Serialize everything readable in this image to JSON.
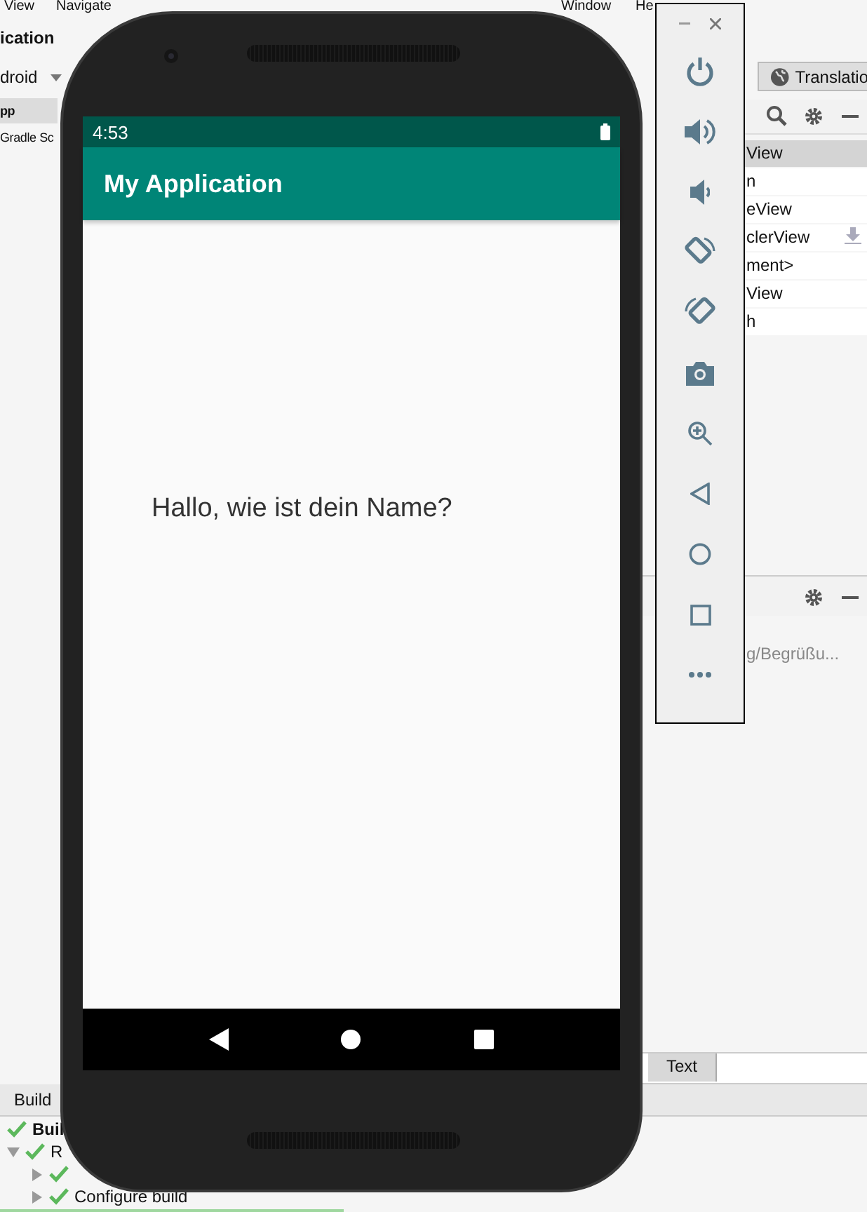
{
  "ide": {
    "menu": [
      "View",
      "Navigate",
      "Window",
      "He"
    ],
    "project_title": "ication",
    "project_view": "droid",
    "project_tree": [
      {
        "label": "pp",
        "selected": true
      },
      {
        "label": "Gradle Sc",
        "selected": false
      }
    ],
    "translations_tab": "Translatio",
    "component_tree": [
      {
        "label": "View",
        "selected": true
      },
      {
        "label": "n",
        "selected": false
      },
      {
        "label": "eView",
        "selected": false
      },
      {
        "label": "clerView",
        "selected": false
      },
      {
        "label": "ment>",
        "selected": false
      },
      {
        "label": "View",
        "selected": false
      },
      {
        "label": "h",
        "selected": false
      }
    ],
    "attribute_value": "g/Begrüßu...",
    "editor_tab": "Text",
    "build_tab": "Build",
    "build_tree": [
      {
        "label": "Buil"
      },
      {
        "label": "R",
        "expanded": true
      },
      {
        "expanded": false
      },
      {
        "label": "Configure build",
        "expanded": false
      }
    ]
  },
  "phone": {
    "time": "4:53",
    "app_title": "My Application",
    "message": "Hallo, wie ist dein Name?"
  }
}
